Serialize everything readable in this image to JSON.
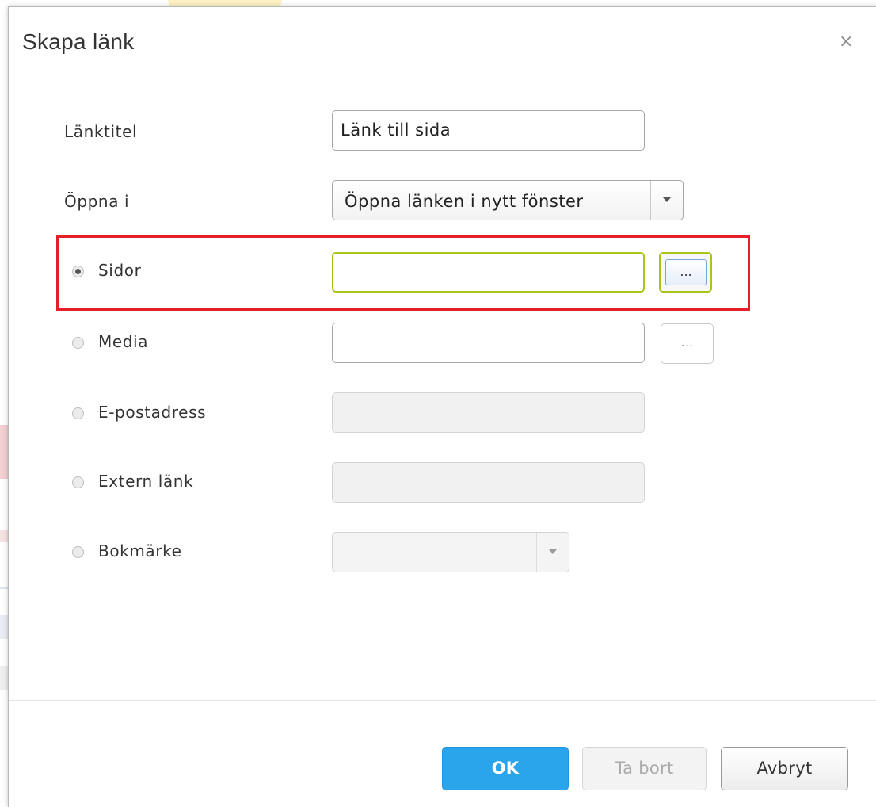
{
  "dialog": {
    "title": "Skapa länk",
    "close_symbol": "×"
  },
  "fields": {
    "link_title": {
      "label": "Länktitel",
      "value": "Länk till sida"
    },
    "open_in": {
      "label": "Öppna i",
      "selected": "Öppna länken i nytt fönster"
    },
    "pages": {
      "label": "Sidor",
      "value": "",
      "checked": true,
      "browse_label": "..."
    },
    "media": {
      "label": "Media",
      "value": "",
      "checked": false,
      "browse_label": "..."
    },
    "email": {
      "label": "E-postadress",
      "value": "",
      "checked": false
    },
    "external": {
      "label": "Extern länk",
      "value": "",
      "checked": false
    },
    "bookmark": {
      "label": "Bokmärke",
      "selected": "",
      "checked": false
    }
  },
  "footer": {
    "ok_label": "OK",
    "remove_label": "Ta bort",
    "cancel_label": "Avbryt"
  },
  "colors": {
    "ok_button": "#2aa5ec",
    "focus_border": "#a6c61a",
    "highlight_box": "#e3202a"
  },
  "icons": {
    "close": "close-icon",
    "dropdown": "chevron-down-icon",
    "radio": "radio-icon"
  }
}
